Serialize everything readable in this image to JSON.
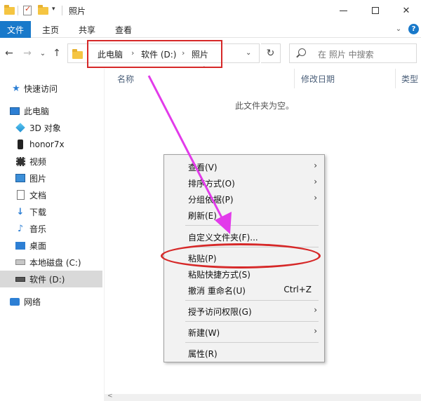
{
  "window": {
    "title": "照片",
    "controls": {
      "minimize_icon": "minimize-icon",
      "maximize_icon": "maximize-icon",
      "close_glyph": "✕"
    }
  },
  "ribbon": {
    "tabs": [
      "文件",
      "主页",
      "共享",
      "查看"
    ]
  },
  "address_bar": {
    "breadcrumbs": [
      "此电脑",
      "软件 (D:)",
      "照片"
    ],
    "separator": "›"
  },
  "search": {
    "placeholder": "在 照片 中搜索"
  },
  "sidebar": {
    "items": [
      {
        "label": "快速访问",
        "icon": "star-icon"
      },
      {
        "label": "此电脑",
        "icon": "computer-icon"
      },
      {
        "label": "3D 对象",
        "icon": "cube-3d-icon"
      },
      {
        "label": "honor7x",
        "icon": "phone-icon"
      },
      {
        "label": "视频",
        "icon": "video-icon"
      },
      {
        "label": "图片",
        "icon": "pictures-icon"
      },
      {
        "label": "文档",
        "icon": "document-icon"
      },
      {
        "label": "下载",
        "icon": "download-icon"
      },
      {
        "label": "音乐",
        "icon": "music-icon"
      },
      {
        "label": "桌面",
        "icon": "desktop-icon"
      },
      {
        "label": "本地磁盘 (C:)",
        "icon": "drive-icon"
      },
      {
        "label": "软件 (D:)",
        "icon": "drive-icon",
        "selected": true
      },
      {
        "label": "网络",
        "icon": "network-icon"
      }
    ]
  },
  "file_list": {
    "columns": [
      "名称",
      "修改日期",
      "类型"
    ],
    "empty_message": "此文件夹为空。"
  },
  "context_menu": {
    "items": [
      {
        "label": "查看(V)",
        "submenu": true
      },
      {
        "label": "排序方式(O)",
        "submenu": true
      },
      {
        "label": "分组依据(P)",
        "submenu": true
      },
      {
        "label": "刷新(E)"
      },
      {
        "label": "自定义文件夹(F)..."
      },
      {
        "label": "粘贴(P)"
      },
      {
        "label": "粘贴快捷方式(S)"
      },
      {
        "label": "撤消 重命名(U)",
        "shortcut": "Ctrl+Z"
      },
      {
        "label": "授予访问权限(G)",
        "submenu": true
      },
      {
        "label": "新建(W)",
        "submenu": true
      },
      {
        "label": "属性(R)"
      }
    ]
  },
  "colors": {
    "accent_blue": "#1979ca",
    "annotation_red": "#d62828",
    "annotation_magenta": "#e23bea",
    "sidebar_selected": "#d9d9d9",
    "menu_bg": "#f2f2f2"
  }
}
